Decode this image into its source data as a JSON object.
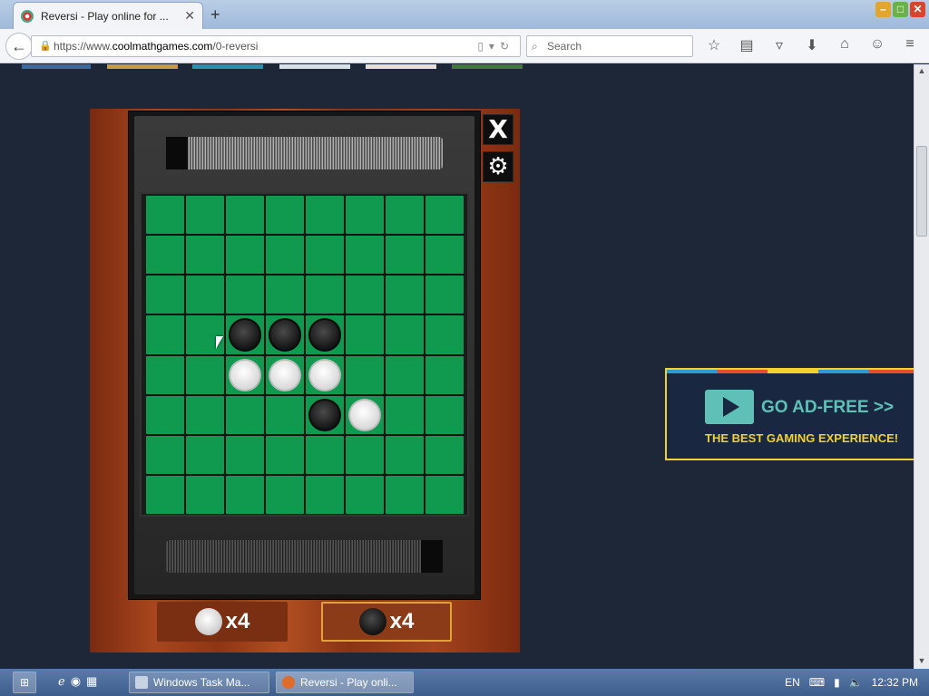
{
  "browser": {
    "tab_title": "Reversi - Play online for ...",
    "tab_close": "✕",
    "new_tab": "+",
    "url_prefix": "https://www.",
    "url_domain": "coolmathgames.com",
    "url_path": "/0-reversi",
    "search_placeholder": "Search",
    "window_buttons": [
      "–",
      "□",
      "✕"
    ]
  },
  "game": {
    "close_label": "X",
    "settings_label": "⚙",
    "board": [
      [
        0,
        0,
        0,
        0,
        0,
        0,
        0,
        0
      ],
      [
        0,
        0,
        0,
        0,
        0,
        0,
        0,
        0
      ],
      [
        0,
        0,
        0,
        0,
        0,
        0,
        0,
        0
      ],
      [
        0,
        0,
        2,
        2,
        2,
        0,
        0,
        0
      ],
      [
        0,
        0,
        1,
        1,
        1,
        0,
        0,
        0
      ],
      [
        0,
        0,
        0,
        0,
        2,
        1,
        0,
        0
      ],
      [
        0,
        0,
        0,
        0,
        0,
        0,
        0,
        0
      ],
      [
        0,
        0,
        0,
        0,
        0,
        0,
        0,
        0
      ]
    ],
    "board_legend": {
      "0": "empty",
      "1": "white",
      "2": "black"
    },
    "white_score": "x4",
    "black_score": "x4",
    "active_player": "black"
  },
  "ad": {
    "headline": "GO AD-FREE >>",
    "subline": "THE BEST GAMING EXPERIENCE!"
  },
  "taskbar": {
    "task_manager": "Windows Task Ma...",
    "browser_task": "Reversi - Play onli...",
    "language": "EN",
    "clock": "12:32 PM"
  },
  "colors": {
    "board_green": "#0f9a50",
    "page_bg": "#1d2737",
    "ad_accent": "#5ec0b7",
    "ad_yellow": "#f2d12d"
  }
}
